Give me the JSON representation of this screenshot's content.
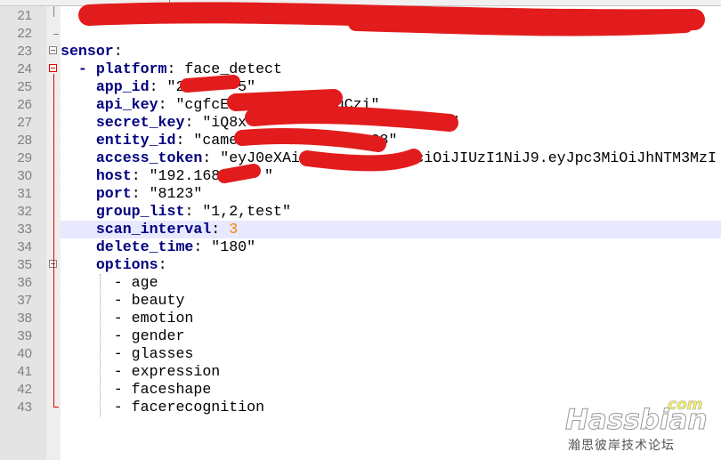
{
  "editor": {
    "lines": [
      {
        "n": "21",
        "parts": [
          {
            "t": "         ",
            "c": ""
          }
        ]
      },
      {
        "n": "22",
        "parts": []
      },
      {
        "n": "23",
        "parts": [
          {
            "t": "sensor",
            "c": "k"
          },
          {
            "t": ":",
            "c": ""
          }
        ]
      },
      {
        "n": "24",
        "parts": [
          {
            "t": "  - ",
            "c": "k"
          },
          {
            "t": "platform",
            "c": "k"
          },
          {
            "t": ": face_detect",
            "c": ""
          }
        ]
      },
      {
        "n": "25",
        "parts": [
          {
            "t": "    ",
            "c": ""
          },
          {
            "t": "app_id",
            "c": "k"
          },
          {
            "t": ": \"2      5\"",
            "c": ""
          }
        ]
      },
      {
        "n": "26",
        "parts": [
          {
            "t": "    ",
            "c": ""
          },
          {
            "t": "api_key",
            "c": "k"
          },
          {
            "t": ": \"cgfcE          mnuCzi\"",
            "c": ""
          }
        ]
      },
      {
        "n": "27",
        "parts": [
          {
            "t": "    ",
            "c": ""
          },
          {
            "t": "secret_key",
            "c": "k"
          },
          {
            "t": ": \"iQ8x                  8cuEi\"",
            "c": ""
          }
        ]
      },
      {
        "n": "28",
        "parts": [
          {
            "t": "    ",
            "c": ""
          },
          {
            "t": "entity_id",
            "c": "k"
          },
          {
            "t": ": \"came            m_s28\"",
            "c": ""
          }
        ]
      },
      {
        "n": "29",
        "parts": [
          {
            "t": "    ",
            "c": ""
          },
          {
            "t": "access_token",
            "c": "k"
          },
          {
            "t": ": \"eyJ0eXAiC            ciOiJIUzI1NiJ9.eyJpc3MiOiJhNTM3MzI",
            "c": ""
          }
        ]
      },
      {
        "n": "30",
        "parts": [
          {
            "t": "    ",
            "c": ""
          },
          {
            "t": "host",
            "c": "k"
          },
          {
            "t": ": \"192.168     \"",
            "c": ""
          }
        ]
      },
      {
        "n": "31",
        "parts": [
          {
            "t": "    ",
            "c": ""
          },
          {
            "t": "port",
            "c": "k"
          },
          {
            "t": ": \"8123\"",
            "c": ""
          }
        ]
      },
      {
        "n": "32",
        "parts": [
          {
            "t": "    ",
            "c": ""
          },
          {
            "t": "group_list",
            "c": "k"
          },
          {
            "t": ": \"1,2,test\"",
            "c": ""
          }
        ]
      },
      {
        "n": "33",
        "parts": [
          {
            "t": "    ",
            "c": ""
          },
          {
            "t": "scan_interval",
            "c": "k"
          },
          {
            "t": ": ",
            "c": ""
          },
          {
            "t": "3",
            "c": "num"
          }
        ],
        "highlight": true
      },
      {
        "n": "34",
        "parts": [
          {
            "t": "    ",
            "c": ""
          },
          {
            "t": "delete_time",
            "c": "k"
          },
          {
            "t": ": \"180\"",
            "c": ""
          }
        ]
      },
      {
        "n": "35",
        "parts": [
          {
            "t": "    ",
            "c": ""
          },
          {
            "t": "options",
            "c": "k"
          },
          {
            "t": ":",
            "c": ""
          }
        ]
      },
      {
        "n": "36",
        "parts": [
          {
            "t": "      - age",
            "c": ""
          }
        ]
      },
      {
        "n": "37",
        "parts": [
          {
            "t": "      - beauty",
            "c": ""
          }
        ]
      },
      {
        "n": "38",
        "parts": [
          {
            "t": "      - emotion",
            "c": ""
          }
        ]
      },
      {
        "n": "39",
        "parts": [
          {
            "t": "      - gender",
            "c": ""
          }
        ]
      },
      {
        "n": "40",
        "parts": [
          {
            "t": "      - glasses",
            "c": ""
          }
        ]
      },
      {
        "n": "41",
        "parts": [
          {
            "t": "      - expression",
            "c": ""
          }
        ]
      },
      {
        "n": "42",
        "parts": [
          {
            "t": "      - faceshape",
            "c": ""
          }
        ]
      },
      {
        "n": "43",
        "parts": [
          {
            "t": "      - facerecognition",
            "c": ""
          }
        ]
      }
    ],
    "colors": {
      "key": "#000080",
      "number": "#ff8000",
      "fold": "#e00000",
      "highlight": "#e8e8ff",
      "redaction": "#e21c1c"
    }
  },
  "watermark": {
    "brand": "Hassbian",
    "tld": "com",
    "subtitle": "瀚思彼岸技术论坛"
  }
}
